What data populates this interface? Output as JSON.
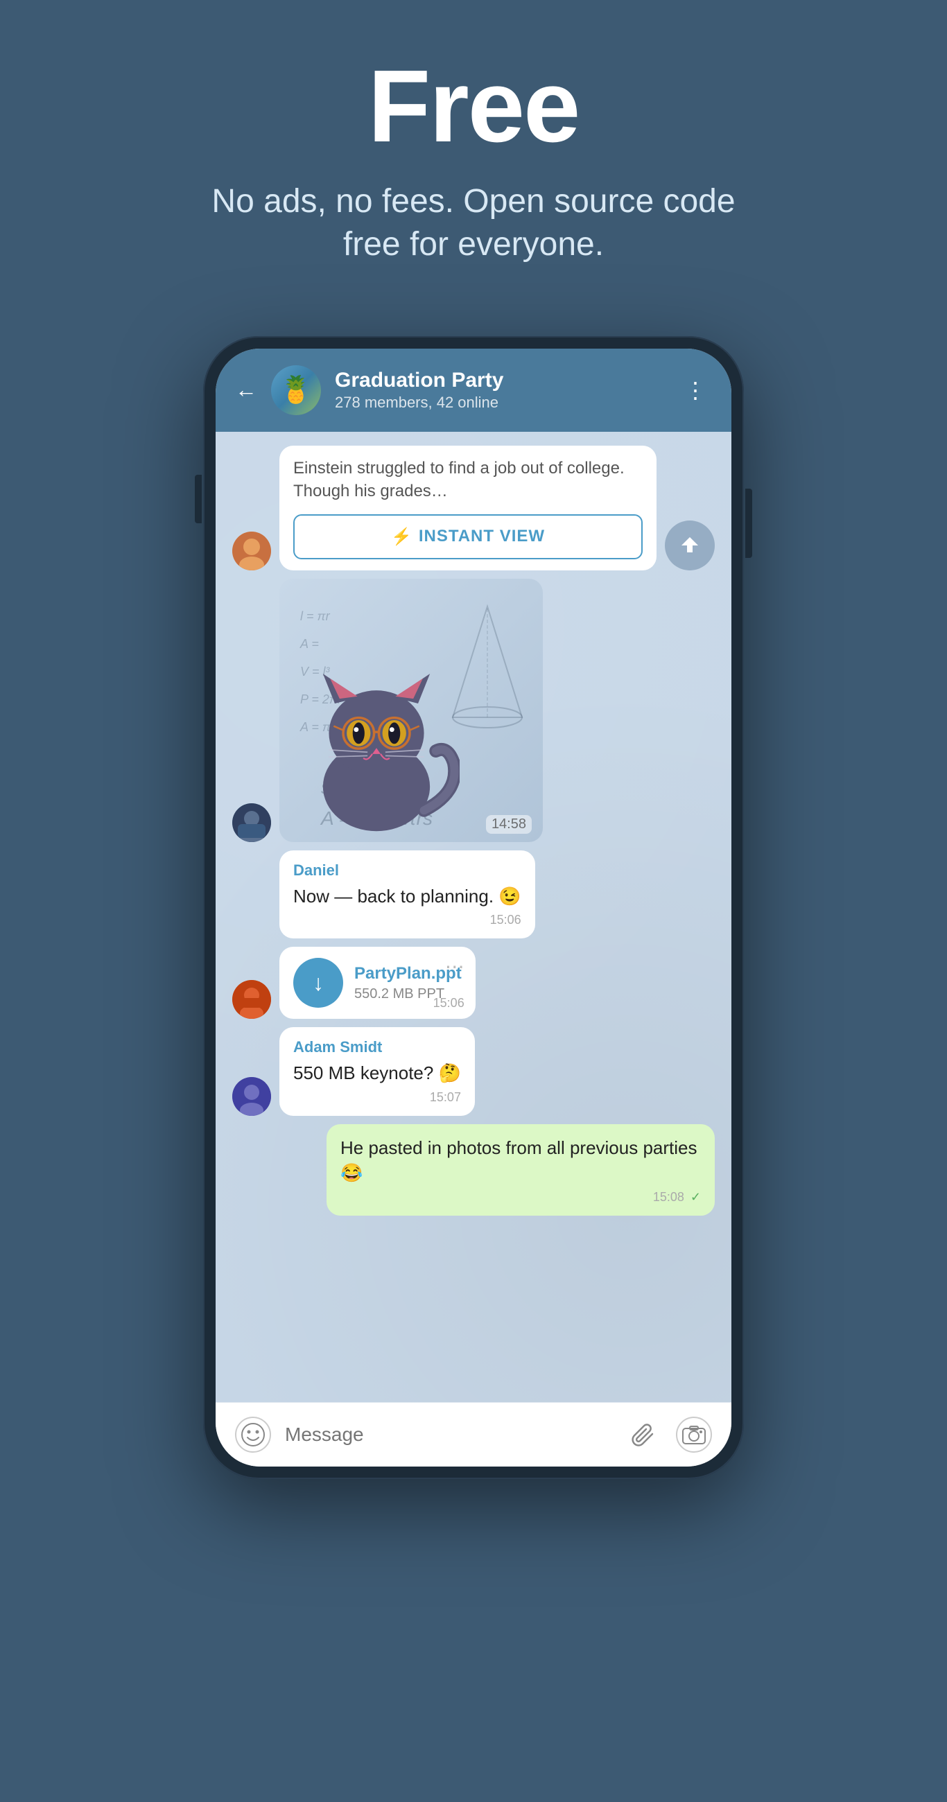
{
  "hero": {
    "title": "Free",
    "subtitle": "No ads, no fees. Open source code free for everyone."
  },
  "chat": {
    "group_name": "Graduation Party",
    "group_meta": "278 members, 42 online",
    "back_label": "←",
    "menu_label": "⋮"
  },
  "messages": [
    {
      "id": "msg1",
      "type": "instant_view",
      "text": "Einstein struggled to find a job out of college. Though his grades…",
      "button_label": "INSTANT VIEW",
      "button_icon": "⚡",
      "has_share": true
    },
    {
      "id": "msg2",
      "type": "sticker",
      "time": "14:58"
    },
    {
      "id": "msg3",
      "type": "text",
      "sender": "Daniel",
      "text": "Now — back to planning. 😉",
      "time": "15:06"
    },
    {
      "id": "msg4",
      "type": "file",
      "file_name": "PartyPlan.ppt",
      "file_size": "550.2 MB PPT",
      "time": "15:06"
    },
    {
      "id": "msg5",
      "type": "text",
      "sender": "Adam Smidt",
      "text": "550 MB keynote? 🤔",
      "time": "15:07"
    },
    {
      "id": "msg6",
      "type": "text_green",
      "text": "He pasted in photos from all previous parties 😂",
      "time": "15:08",
      "has_check": true
    }
  ],
  "input": {
    "placeholder": "Message"
  },
  "math_formulas": "l = πr²\nA =\nV = l³\nP = 2πr\nA = πr²\nL   θ\n\ns = √(r² + h²)\nA = πr² + πrs"
}
